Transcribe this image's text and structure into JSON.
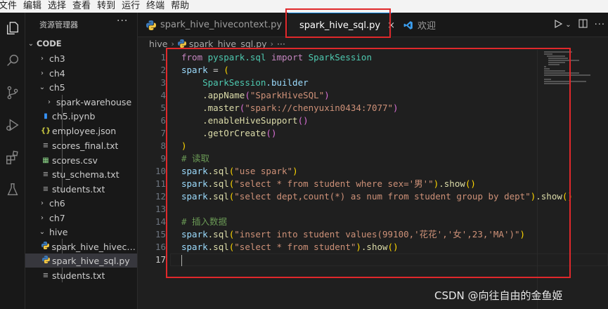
{
  "menu": [
    "文件",
    "编辑",
    "选择",
    "查看",
    "转到",
    "运行",
    "终端",
    "帮助"
  ],
  "activity_icons": [
    "explorer-icon",
    "search-icon",
    "source-control-icon",
    "run-debug-icon",
    "extensions-icon",
    "testing-icon"
  ],
  "sidebar": {
    "title": "资源管理器",
    "more": "···",
    "root": "CODE",
    "items": [
      {
        "label": "ch3",
        "type": "folder",
        "expanded": false,
        "depth": 1
      },
      {
        "label": "ch4",
        "type": "folder",
        "expanded": false,
        "depth": 1
      },
      {
        "label": "ch5",
        "type": "folder",
        "expanded": true,
        "depth": 1
      },
      {
        "label": "spark-warehouse",
        "type": "folder",
        "expanded": false,
        "depth": 2
      },
      {
        "label": "ch5.ipynb",
        "type": "notebook",
        "depth": 2
      },
      {
        "label": "employee.json",
        "type": "json",
        "depth": 2
      },
      {
        "label": "scores_final.txt",
        "type": "text",
        "depth": 2
      },
      {
        "label": "scores.csv",
        "type": "csv",
        "depth": 2
      },
      {
        "label": "stu_schema.txt",
        "type": "text",
        "depth": 2
      },
      {
        "label": "students.txt",
        "type": "text",
        "depth": 2
      },
      {
        "label": "ch6",
        "type": "folder",
        "expanded": false,
        "depth": 1
      },
      {
        "label": "ch7",
        "type": "folder",
        "expanded": false,
        "depth": 1
      },
      {
        "label": "hive",
        "type": "folder",
        "expanded": true,
        "depth": 1
      },
      {
        "label": "spark_hive_hiveco…",
        "type": "python",
        "depth": 2
      },
      {
        "label": "spark_hive_sql.py",
        "type": "python",
        "depth": 2,
        "selected": true
      },
      {
        "label": "students.txt",
        "type": "text",
        "depth": 2
      }
    ]
  },
  "tabs": [
    {
      "label": "spark_hive_hivecontext.py",
      "active": false
    },
    {
      "label": "spark_hive_sql.py",
      "active": true,
      "close": "×"
    },
    {
      "label": "欢迎",
      "active": false
    }
  ],
  "breadcrumb": {
    "folder": "hive",
    "file": "spark_hive_sql.py",
    "more": "···"
  },
  "editor": {
    "line_numbers": [
      "1",
      "2",
      "3",
      "4",
      "5",
      "6",
      "7",
      "8",
      "9",
      "10",
      "11",
      "12",
      "13",
      "14",
      "15",
      "16",
      "17"
    ],
    "current_line": "17",
    "code": {
      "l1_from": "from",
      "l1_mod": "pyspark.sql",
      "l1_import": "import",
      "l1_cls": "SparkSession",
      "l2_var": "spark",
      "l2_eq": " = ",
      "l2_paren": "(",
      "l3_cls": "SparkSession",
      "l3_attr": ".builder",
      "l4_fn": ".appName",
      "l4_str": "\"SparkHiveSQL\"",
      "l5_fn": ".master",
      "l5_str": "\"spark://chenyuxin0434:7077\"",
      "l6_fn": ".enableHiveSupport",
      "l6_args": "()",
      "l7_fn": ".getOrCreate",
      "l7_args": "()",
      "l8_paren": ")",
      "l9_comment": "# 读取",
      "l10_var": "spark",
      "l10_fn": ".sql",
      "l10_str": "\"use spark\"",
      "l11_var": "spark",
      "l11_fn": ".sql",
      "l11_str": "\"select * from student where sex='男'\"",
      "l11_show": ".show",
      "l12_var": "spark",
      "l12_fn": ".sql",
      "l12_str": "\"select dept,count(*) as num from student group by dept\"",
      "l12_show": ".show",
      "l14_comment": "# 插入数据",
      "l15_var": "spark",
      "l15_fn": ".sql",
      "l15_str": "\"insert into student values(99100,'花花','女',23,'MA')\"",
      "l16_var": "spark",
      "l16_fn": ".sql",
      "l16_str": "\"select * from student\"",
      "l16_show": ".show"
    }
  },
  "watermark": "CSDN @向往自由的金鱼姬",
  "colors": {
    "accent": "#0078d4",
    "annotation_red": "#e0282b"
  }
}
